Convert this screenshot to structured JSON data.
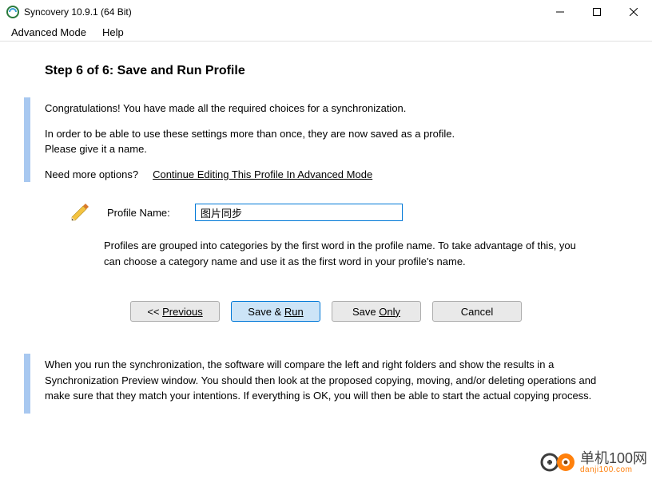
{
  "window": {
    "title": "Syncovery 10.9.1 (64 Bit)"
  },
  "menu": {
    "advanced": "Advanced Mode",
    "help": "Help"
  },
  "header": {
    "title": "Step 6 of 6: Save and Run Profile"
  },
  "intro": {
    "congrats": "Congratulations! You have made all the required choices for a synchronization.",
    "save_info": "In order to be able to use these settings more than once, they are now saved as a profile.",
    "give_name": "Please give it a name.",
    "need_more": "Need more options?",
    "adv_link": "Continue Editing This Profile In Advanced Mode"
  },
  "profile": {
    "label": "Profile Name:",
    "value": "图片同步"
  },
  "hint": "Profiles are grouped into categories by the first word in the profile name. To take advantage of this, you can choose a category name and use it as the first word in your profile's name.",
  "buttons": {
    "previous_prefix": "<< ",
    "previous": "Previous",
    "save_run_a": "Save & ",
    "save_run_b": "Run",
    "save_only_a": "Save ",
    "save_only_b": "Only",
    "cancel": "Cancel"
  },
  "footer": {
    "text": "When you run the synchronization, the software will compare the left and right folders and show the results in a Synchronization Preview window. You should then look at the proposed copying, moving, and/or deleting operations and make sure that they match your intentions. If everything is OK, you will then be able to start the actual copying process."
  },
  "watermark": {
    "main": "单机100网",
    "sub": "danji100.com"
  }
}
